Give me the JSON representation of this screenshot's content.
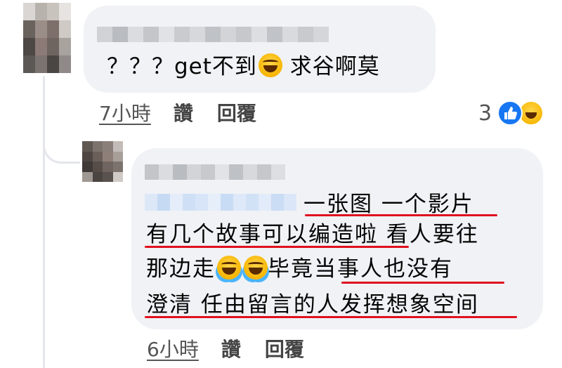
{
  "main_comment": {
    "text_before_emoji": "？？？get不到",
    "emoji": "rofl-emoji",
    "text_after_emoji": " 求谷啊莫",
    "time": "7小時",
    "like_label": "讚",
    "reply_label": "回覆",
    "reaction_count": "3",
    "reactions": [
      "like-icon",
      "haha-icon"
    ]
  },
  "reply_comment": {
    "line1": "一张图 一个影片",
    "line2": "有几个故事可以编造啦 看人要往",
    "line3_before": "那边走",
    "line3_emojis": [
      "joy-emoji",
      "joy-emoji"
    ],
    "line3_after": "毕竟当事人也没有",
    "line4": "澄清 任由留言的人发挥想象空间",
    "time": "6小時",
    "like_label": "讚",
    "reply_label": "回覆"
  },
  "colors": {
    "bubble": "#f0f2f5",
    "underline": "#e0101f",
    "like_blue": "#1877f2"
  }
}
